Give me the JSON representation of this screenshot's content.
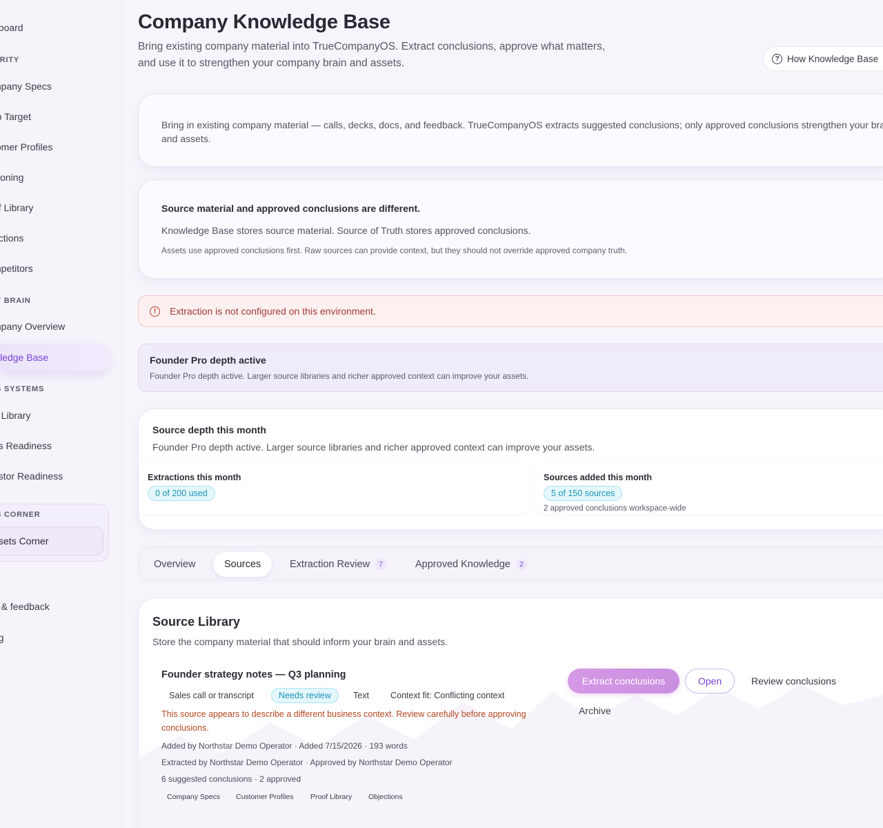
{
  "sidebar": {
    "items": [
      {
        "label": "hboard"
      },
      {
        "label": "mpany Specs"
      },
      {
        "label": "rp Target"
      },
      {
        "label": "tomer Profiles"
      },
      {
        "label": "itioning"
      },
      {
        "label": "of Library"
      },
      {
        "label": "ections"
      },
      {
        "label": "mpetitors"
      },
      {
        "label": "mpany Overview"
      },
      {
        "label": "wledge Base"
      },
      {
        "label": "h Library"
      },
      {
        "label": "es Readiness"
      },
      {
        "label": "estor Readiness"
      },
      {
        "label": "ssets Corner"
      },
      {
        "label": "s"
      },
      {
        "label": "p & feedback"
      },
      {
        "label": "ng"
      }
    ],
    "sections": [
      "ARITY",
      "Y BRAIN",
      "S SYSTEMS",
      "S CORNER"
    ]
  },
  "header": {
    "title": "Company Knowledge Base",
    "subtitle": "Bring existing company material into TrueCompanyOS. Extract conclusions, approve what matters, and use it to strengthen your company brain and assets.",
    "help_button": "How Knowledge Base"
  },
  "intro": {
    "text": "Bring in existing company material — calls, decks, docs, and feedback. TrueCompanyOS extracts suggested conclusions; only approved conclusions strengthen your brain and assets."
  },
  "difference": {
    "title": "Source material and approved conclusions are different.",
    "line1": "Knowledge Base stores source material. Source of Truth stores approved conclusions.",
    "line2": "Assets use approved conclusions first. Raw sources can provide context, but they should not override approved company truth."
  },
  "alert": {
    "text": "Extraction is not configured on this environment."
  },
  "pro": {
    "title": "Founder Pro depth active",
    "subtitle": "Founder Pro depth active. Larger source libraries and richer approved context can improve your assets."
  },
  "depth": {
    "title": "Source depth this month",
    "subtitle": "Founder Pro depth active. Larger source libraries and richer approved context can improve your assets.",
    "extractions_label": "Extractions this month",
    "extractions_value": "0 of 200 used",
    "sources_label": "Sources added this month",
    "sources_value": "5 of 150 sources",
    "sources_note": "2 approved conclusions workspace-wide"
  },
  "tabs": [
    {
      "label": "Overview"
    },
    {
      "label": "Sources"
    },
    {
      "label": "Extraction Review",
      "badge": "7"
    },
    {
      "label": "Approved Knowledge",
      "badge": "2"
    }
  ],
  "library": {
    "title": "Source Library",
    "subtitle": "Store the company material that should inform your brain and assets.",
    "source": {
      "title": "Founder strategy notes — Q3 planning",
      "type": "Sales call or transcript",
      "status": "Needs review",
      "format": "Text",
      "context_fit": "Context fit: Conflicting context",
      "warning": "This source appears to describe a different business context. Review carefully before approving conclusions.",
      "meta1": "Added by Northstar Demo Operator · Added 7/15/2026 · 193 words",
      "meta2": "Extracted by Northstar Demo Operator · Approved by Northstar Demo Operator",
      "meta3": "6 suggested conclusions · 2 approved",
      "chips": [
        "Company Specs",
        "Customer Profiles",
        "Proof Library",
        "Objections"
      ],
      "actions": {
        "extract": "Extract conclusions",
        "open": "Open",
        "review": "Review conclusions",
        "archive": "Archive"
      }
    }
  }
}
